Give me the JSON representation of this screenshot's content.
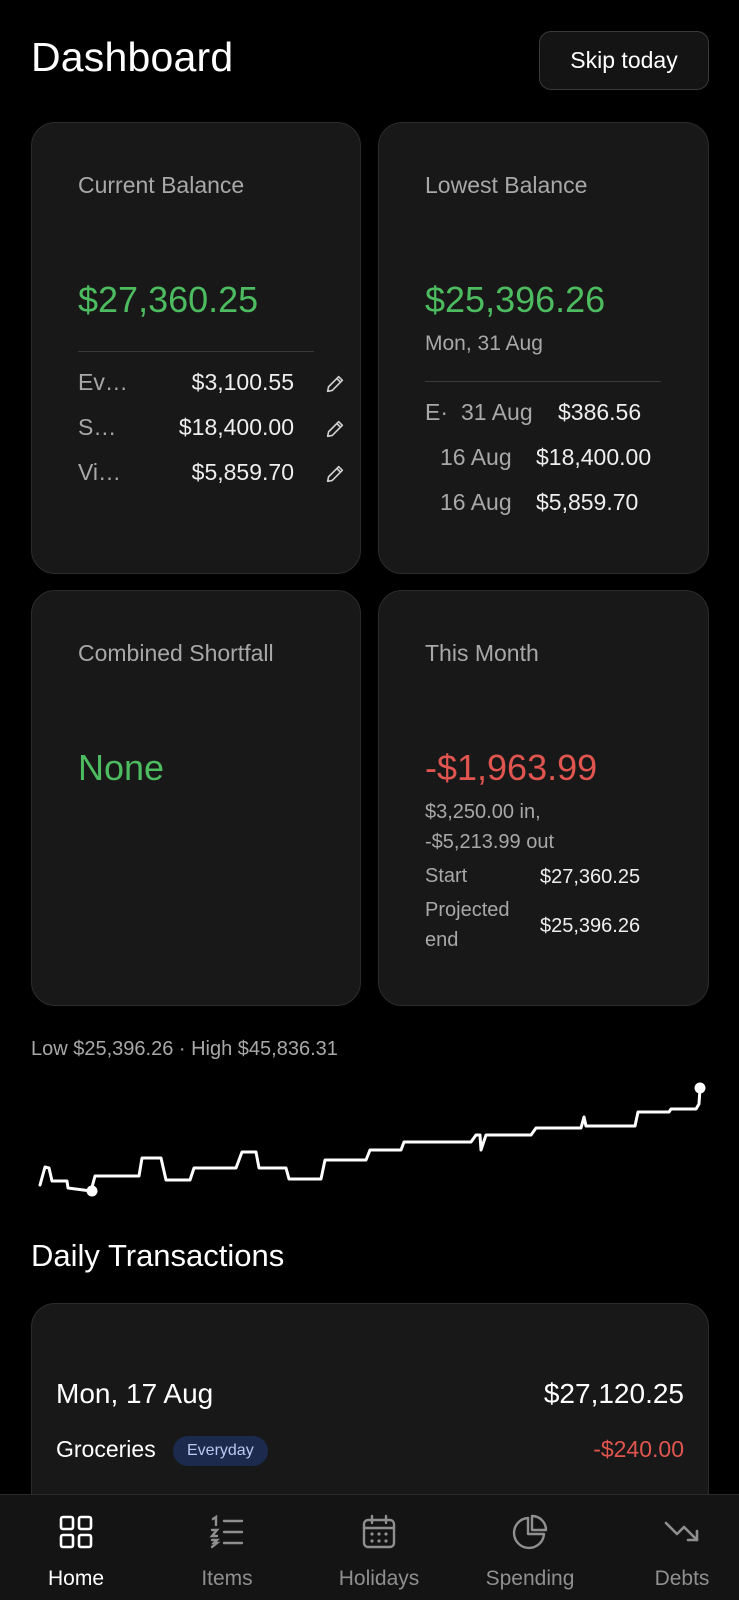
{
  "header": {
    "title": "Dashboard",
    "skip_button": "Skip today"
  },
  "current_balance": {
    "title": "Current Balance",
    "value": "$27,360.25",
    "accounts": [
      {
        "name": "Ev…",
        "amount": "$3,100.55"
      },
      {
        "name": "S…",
        "amount": "$18,400.00"
      },
      {
        "name": "Vi…",
        "amount": "$5,859.70"
      }
    ]
  },
  "lowest_balance": {
    "title": "Lowest Balance",
    "value": "$25,396.26",
    "date": "Mon, 31 Aug",
    "rows": [
      {
        "prefix": "E·",
        "date": "31 Aug",
        "amount": "$386.56"
      },
      {
        "prefix": "",
        "date": "16 Aug",
        "amount": "$18,400.00"
      },
      {
        "prefix": "",
        "date": "16 Aug",
        "amount": "$5,859.70"
      }
    ]
  },
  "shortfall": {
    "title": "Combined Shortfall",
    "value": "None"
  },
  "this_month": {
    "title": "This Month",
    "value": "-$1,963.99",
    "in_text": "$3,250.00 in,",
    "out_text": "-$5,213.99 out",
    "start_label": "Start",
    "start_value": "$27,360.25",
    "projected_label_1": "Projected",
    "projected_label_2": "end",
    "projected_value": "$25,396.26"
  },
  "sparkline": {
    "range_text": "Low $25,396.26 · High $45,836.31",
    "low": 25396.26,
    "high": 45836.31
  },
  "daily": {
    "section_title": "Daily Transactions",
    "date": "Mon, 17 Aug",
    "balance": "$27,120.25",
    "item_name": "Groceries",
    "item_badge": "Everyday",
    "item_amount": "-$240.00"
  },
  "tabs": [
    {
      "label": "Home",
      "icon": "home-grid-icon",
      "active": true
    },
    {
      "label": "Items",
      "icon": "list-icon",
      "active": false
    },
    {
      "label": "Holidays",
      "icon": "calendar-icon",
      "active": false
    },
    {
      "label": "Spending",
      "icon": "pie-chart-icon",
      "active": false
    },
    {
      "label": "Debts",
      "icon": "trend-down-icon",
      "active": false
    }
  ],
  "colors": {
    "positive": "#4dbb5f",
    "negative": "#e0554f",
    "card_bg": "#181818"
  }
}
